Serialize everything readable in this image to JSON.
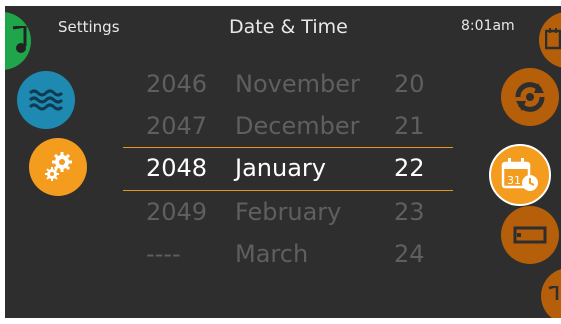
{
  "header": {
    "left_label": "Settings",
    "title": "Date & Time",
    "clock": "8:01am"
  },
  "picker": {
    "rows": [
      {
        "year": "2046",
        "month": "November",
        "day": "20"
      },
      {
        "year": "2047",
        "month": "December",
        "day": "21"
      },
      {
        "year": "2048",
        "month": "January",
        "day": "22",
        "selected": true
      },
      {
        "year": "2049",
        "month": "February",
        "day": "23"
      },
      {
        "year": "----",
        "month": "March",
        "day": "24"
      }
    ]
  },
  "icons": {
    "left": [
      "music-icon",
      "water-icon",
      "settings-gears-icon"
    ],
    "right": [
      "calendar-edit-icon",
      "refresh-cycle-icon",
      "date-time-icon",
      "display-icon",
      "partial-icon"
    ]
  },
  "colors": {
    "background": "#2e2e2e",
    "accent_orange": "#f39c1e",
    "dark_orange": "#b55f0a",
    "blue": "#1e8ab2",
    "green": "#1fa64a",
    "selection_line": "#e8922a",
    "text_dim": "#5f5f5f",
    "text_bright": "#ffffff"
  }
}
